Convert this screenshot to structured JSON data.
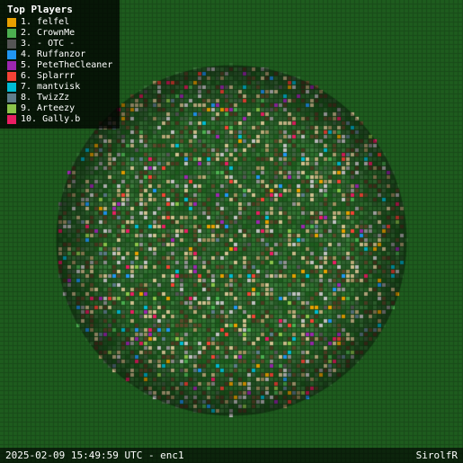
{
  "legend": {
    "title": "Top Players",
    "items": [
      {
        "rank": "1",
        "name": "felfel",
        "color": "#e8a000"
      },
      {
        "rank": "2",
        "name": "CrownMe",
        "color": "#4caf50"
      },
      {
        "rank": "3",
        "name": "- OTC -",
        "color": "#555555"
      },
      {
        "rank": "4",
        "name": "Ruffanzor",
        "color": "#2196f3"
      },
      {
        "rank": "5",
        "name": "PeteTheCleaner",
        "color": "#9c27b0"
      },
      {
        "rank": "6",
        "name": "Splarrr",
        "color": "#f44336"
      },
      {
        "rank": "7",
        "name": "mantvisk",
        "color": "#00bcd4"
      },
      {
        "rank": "8",
        "name": "TwizZz",
        "color": "#607d8b"
      },
      {
        "rank": "9",
        "name": "Arteezy",
        "color": "#8bc34a"
      },
      {
        "rank": "10",
        "name": "Gally.b",
        "color": "#e91e63"
      }
    ]
  },
  "bottom": {
    "timestamp": "2025-02-09 15:49:59 UTC - enc1",
    "server": "SirolfR"
  }
}
